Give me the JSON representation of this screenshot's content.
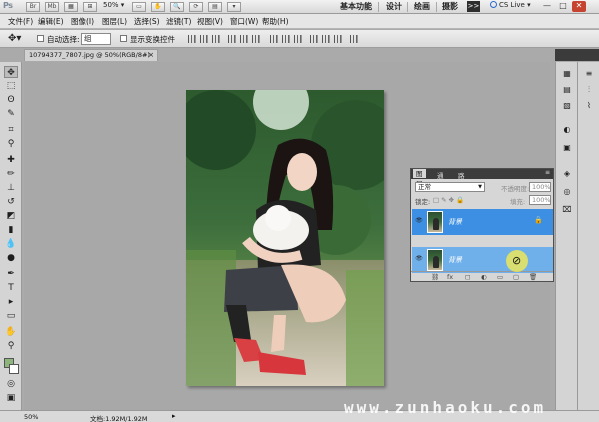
{
  "app": {
    "logo": "Ps",
    "zoom": "50%",
    "workspaces": [
      "基本功能",
      "设计",
      "绘画",
      "摄影"
    ],
    "more": ">>",
    "cs_live": "CS Live",
    "window_controls": [
      "—",
      "□",
      "✕"
    ]
  },
  "menu": [
    "文件(F)",
    "编辑(E)",
    "图像(I)",
    "图层(L)",
    "选择(S)",
    "滤镜(T)",
    "视图(V)",
    "窗口(W)",
    "帮助(H)"
  ],
  "options": {
    "auto_select_label": "自动选择:",
    "auto_select_value": "组",
    "show_transform_label": "显示变换控件"
  },
  "document": {
    "tab_title": "10794377_7807.jpg @ 50%(RGB/8#)",
    "close": "×"
  },
  "layers_panel": {
    "tabs": [
      "图层",
      "通道",
      "路径"
    ],
    "menu_icon": "≡",
    "blend_mode": "正常",
    "opacity_label": "不透明度:",
    "opacity_value": "100%",
    "lock_label": "锁定:",
    "fill_label": "填充:",
    "fill_value": "100%",
    "layers": [
      {
        "name": "背景",
        "selected": true
      },
      {
        "name": "背景",
        "selected": false
      }
    ],
    "footer_icons": [
      "link-icon",
      "fx-icon",
      "mask-icon",
      "adjustment-icon",
      "folder-icon",
      "new-layer-icon",
      "trash-icon"
    ]
  },
  "status": {
    "zoom": "50%",
    "doc_size": "文档:1.92M/1.92M"
  },
  "watermark": "www.zunhaoku.com",
  "colors": {
    "foreground": "#8eb67c",
    "background": "#ffffff",
    "layer_selected": "#3d8fe3",
    "layer_highlight": "#6fb0ea"
  }
}
